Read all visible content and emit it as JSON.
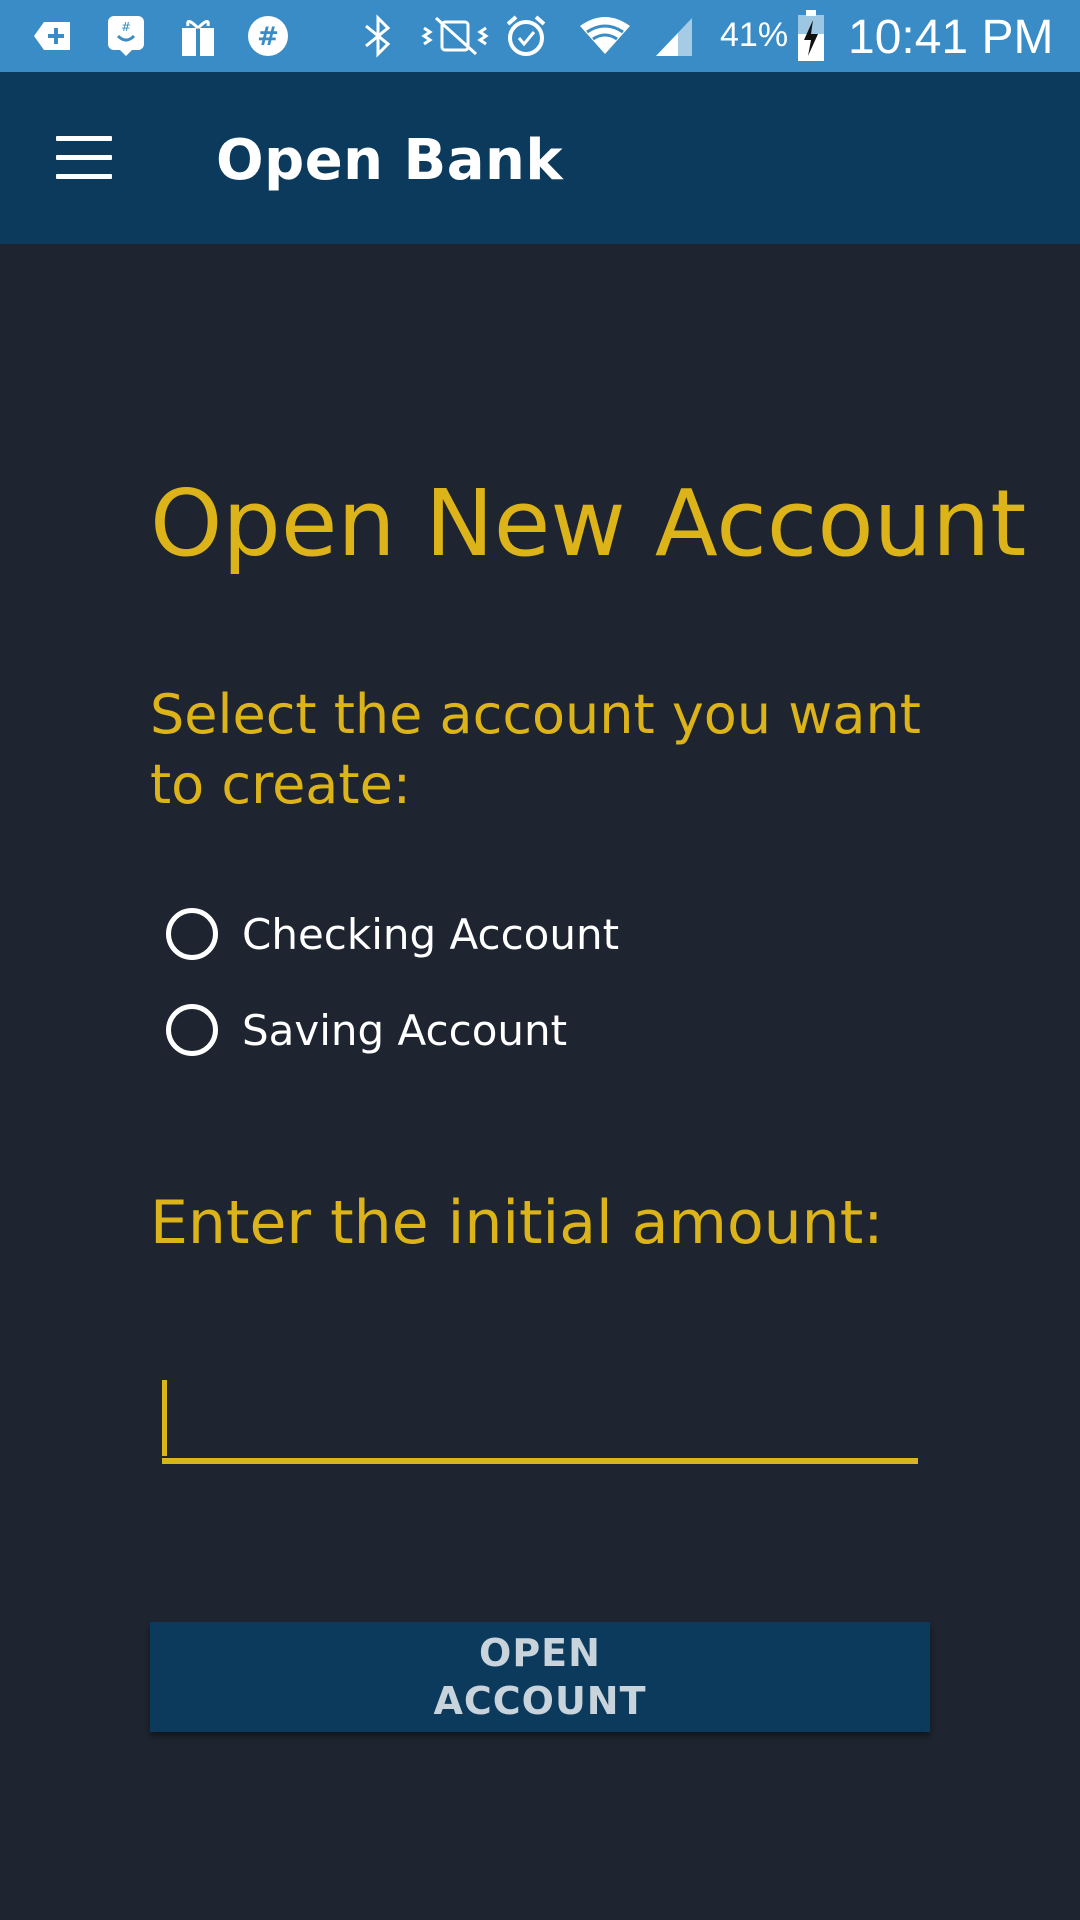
{
  "status_bar": {
    "battery_percent": "41%",
    "time": "10:41 PM",
    "icons": [
      "plus-icon",
      "assistant-icon",
      "gift-icon",
      "slack-icon",
      "bluetooth-icon",
      "vibrate-icon",
      "alarm-icon",
      "wifi-icon",
      "signal-icon",
      "battery-charging-icon"
    ]
  },
  "app_bar": {
    "title": "Open Bank",
    "menu_icon": "hamburger-menu-icon"
  },
  "form": {
    "title": "Open New Account",
    "select_prompt": "Select the account you want to create:",
    "account_options": [
      {
        "label": "Checking Account",
        "selected": false
      },
      {
        "label": "Saving Account",
        "selected": false
      }
    ],
    "amount_prompt": "Enter the initial amount:",
    "amount_value": "",
    "submit_label": "OPEN ACCOUNT"
  },
  "colors": {
    "accent": "#dcb419",
    "app_bar": "#0b3a5c",
    "background": "#1e2530",
    "status_bar": "#3a8cc6"
  }
}
